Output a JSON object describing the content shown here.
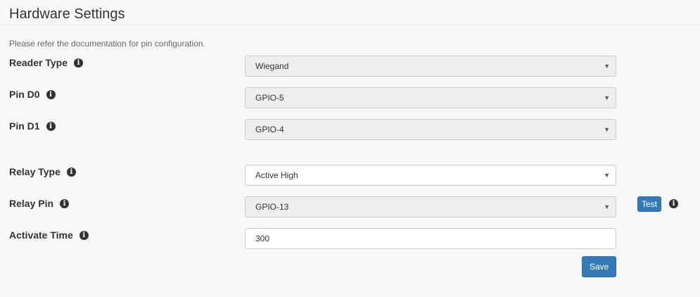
{
  "page": {
    "title": "Hardware Settings",
    "note": "Please refer the documentation for pin configuration."
  },
  "fields": {
    "reader_type": {
      "label": "Reader Type",
      "value": "Wiegand",
      "disabled": true
    },
    "pin_d0": {
      "label": "Pin D0",
      "value": "GPIO-5",
      "disabled": true
    },
    "pin_d1": {
      "label": "Pin D1",
      "value": "GPIO-4",
      "disabled": true
    },
    "relay_type": {
      "label": "Relay Type",
      "value": "Active High",
      "disabled": false
    },
    "relay_pin": {
      "label": "Relay Pin",
      "value": "GPIO-13",
      "disabled": true
    },
    "activate_time": {
      "label": "Activate Time",
      "value": "300"
    }
  },
  "buttons": {
    "test_label": "Test",
    "save_label": "Save"
  },
  "icons": {
    "info": "info-icon",
    "caret": "caret-down-icon"
  },
  "colors": {
    "primary": "#337ab7",
    "disabled_bg": "#eeeeee",
    "page_bg": "#f8f8f8"
  }
}
